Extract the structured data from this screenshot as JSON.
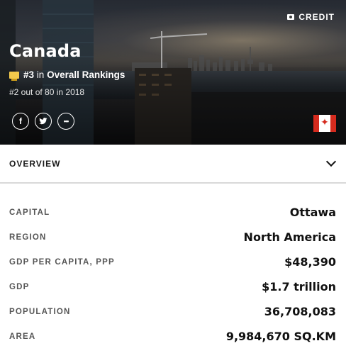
{
  "hero": {
    "credit_label": "CREDIT",
    "country": "Canada",
    "rank_prefix": "#3",
    "rank_in": "in",
    "rank_category": "Overall Rankings",
    "previous_rank": "#2 out of 80 in 2018",
    "social": {
      "facebook": "f",
      "twitter": "t",
      "more": "•••"
    },
    "flag_colors": {
      "red": "#d52b1e",
      "white": "#ffffff"
    }
  },
  "overview": {
    "label": "OVERVIEW"
  },
  "facts": [
    {
      "key": "CAPITAL",
      "value": "Ottawa"
    },
    {
      "key": "REGION",
      "value": "North America"
    },
    {
      "key": "GDP PER CAPITA, PPP",
      "value": "$48,390"
    },
    {
      "key": "GDP",
      "value": "$1.7 trillion"
    },
    {
      "key": "POPULATION",
      "value": "36,708,083"
    },
    {
      "key": "AREA",
      "value": "9,984,670 SQ.KM"
    }
  ]
}
